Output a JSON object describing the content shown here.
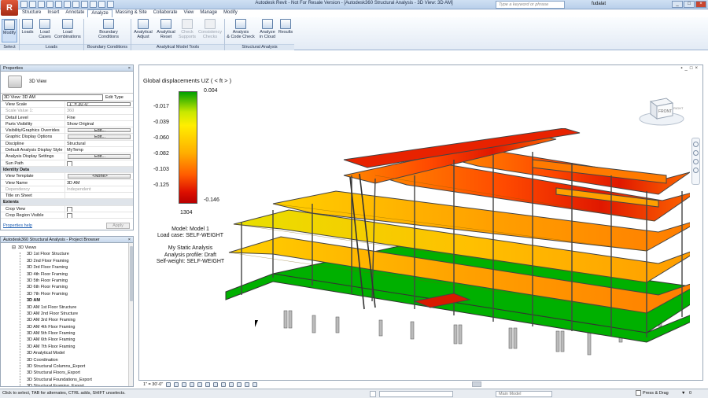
{
  "window": {
    "title": "Autodesk Revit - Not For Resale Version - [Autodesk360 Structural Analysis - 3D View: 3D AM]",
    "search_placeholder": "Type a keyword or phrase",
    "user": "fudalat",
    "app_letter": "R"
  },
  "tabs": [
    "Structure",
    "Insert",
    "Annotate",
    "Analyze",
    "Massing & Site",
    "Collaborate",
    "View",
    "Manage",
    "Modify"
  ],
  "active_tab": "Analyze",
  "ribbon": {
    "buttons": {
      "modify": "Modify",
      "loads": "Loads",
      "load_cases": "Load\nCases",
      "load_combinations": "Load\nCombinations",
      "boundary_conditions": "Boundary\nConditions",
      "analytical_adjust": "Analytical\nAdjust",
      "analytical_reset": "Analytical\nReset",
      "check_supports": "Check\nSupports",
      "consistency_checks": "Consistency\nChecks",
      "analysis_code_check": "Analysis\n& Code Check",
      "analyze_in_cloud": "Analyze\nin Cloud",
      "results": "Results"
    },
    "groups": {
      "select": "Select",
      "loads": "Loads",
      "boundary": "Boundary Conditions",
      "analytical_tools": "Analytical Model Tools",
      "structural_analysis": "Structural Analysis"
    }
  },
  "properties": {
    "header": "Properties",
    "type_name": "3D View",
    "instance_dropdown": "3D View: 3D AM",
    "edit_type": "Edit Type",
    "rows": [
      {
        "k": "View Scale",
        "v": "1\" = 30'-0\"",
        "style": "box"
      },
      {
        "k": "Scale Value    1:",
        "v": "360",
        "style": "dis"
      },
      {
        "k": "Detail Level",
        "v": "Fine",
        "style": ""
      },
      {
        "k": "Parts Visibility",
        "v": "Show Original",
        "style": ""
      },
      {
        "k": "Visibility/Graphics Overrides",
        "v": "Edit...",
        "style": "btn"
      },
      {
        "k": "Graphic Display Options",
        "v": "Edit...",
        "style": "btn"
      },
      {
        "k": "Discipline",
        "v": "Structural",
        "style": ""
      },
      {
        "k": "Default Analysis Display Style",
        "v": "MyTemp",
        "style": ""
      },
      {
        "k": "Analysis Display Settings",
        "v": "Edit...",
        "style": "btn"
      },
      {
        "k": "Sun Path",
        "v": "",
        "style": "chk"
      },
      {
        "k": "Identity Data",
        "v": "",
        "style": "sec"
      },
      {
        "k": "View Template",
        "v": "<None>",
        "style": "btn"
      },
      {
        "k": "View Name",
        "v": "3D AM",
        "style": ""
      },
      {
        "k": "Dependency",
        "v": "Independent",
        "style": "dis"
      },
      {
        "k": "Title on Sheet",
        "v": "",
        "style": ""
      },
      {
        "k": "Extents",
        "v": "",
        "style": "sec"
      },
      {
        "k": "Crop View",
        "v": "",
        "style": "chk"
      },
      {
        "k": "Crop Region Visible",
        "v": "",
        "style": "chk"
      }
    ],
    "help_link": "Properties help",
    "apply": "Apply"
  },
  "browser": {
    "header": "Autodesk360 Structural Analysis - Project Browser",
    "root": "3D Views",
    "items": [
      "3D 1st Floor Structure",
      "3D 2nd Floor Framing",
      "3D 3rd Floor Framing",
      "3D 4th Floor Framing",
      "3D 5th Floor Framing",
      "3D 6th Floor Framing",
      "3D 7th Floor Framing",
      "3D AM",
      "3D AM 1st Floor Structure",
      "3D AM 2nd Floor Structure",
      "3D AM 3rd Floor Framing",
      "3D AM 4th Floor Framing",
      "3D AM 5th Floor Framing",
      "3D AM 6th Floor Framing",
      "3D AM 7th Floor Framing",
      "3D Analytical Model",
      "3D Coordination",
      "3D Structural Columns_Export",
      "3D Structural Floors_Export",
      "3D Structural Foundations_Export",
      "3D Structural Framing_Export"
    ],
    "selected": "3D AM"
  },
  "legend": {
    "title": "Global displacements UZ  ( < ft > )",
    "max": "0.004",
    "min": "-0.146",
    "ticks": [
      "-0.017",
      "-0.039",
      "-0.060",
      "-0.082",
      "-0.103",
      "-0.125"
    ],
    "node": "1304",
    "colors": [
      "#00a000",
      "#c8e800",
      "#ffee00",
      "#ffae00",
      "#ff5a00",
      "#dd1000",
      "#b80000"
    ]
  },
  "model_info": {
    "model": "Model: Model 1",
    "load_case": "Load case: SELF-WEIGHT",
    "analysis": "My Static Analysis",
    "profile": "Analysis profile: Draft",
    "self_weight": "Self-weight: SELF-WEIGHT"
  },
  "viewcube": {
    "front": "FRONT",
    "right": "RIGHT"
  },
  "view_controls": {
    "scale": "1\" = 30'-0\""
  },
  "status": {
    "message": "Click to select, TAB for alternates, CTRL adds, SHIFT unselects.",
    "model_dropdown": "Main Model",
    "press_drag": "Press & Drag",
    "filter_count": "0"
  }
}
